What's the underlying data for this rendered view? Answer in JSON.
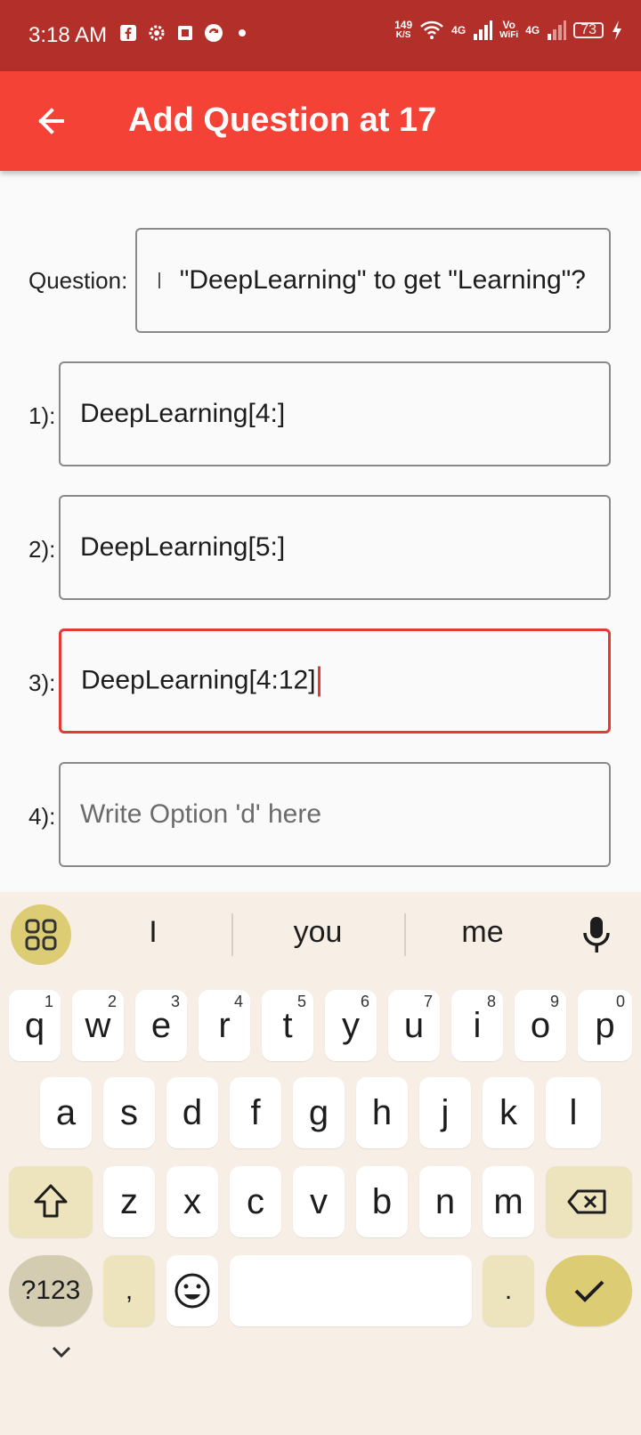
{
  "status_bar": {
    "time": "3:18 AM",
    "net_speed_value": "149",
    "net_speed_unit": "K/S",
    "network_label_1": "4G",
    "volte_label": "Vo",
    "volte_wifi_label": "WiFi",
    "network_label_2": "4G",
    "battery_level": "73",
    "icons": [
      "facebook-icon",
      "gear-icon",
      "notification-icon",
      "sync-icon",
      "dot-icon",
      "wifi-icon",
      "signal-icon",
      "charging-icon"
    ]
  },
  "app_bar": {
    "title": "Add Question at 17",
    "back_icon": "arrow-back-icon"
  },
  "form": {
    "question_label": "Question:",
    "question_value": "\"DeepLearning\" to get \"Learning\"?",
    "options": [
      {
        "label": "1):",
        "value": "DeepLearning[4:]",
        "placeholder": ""
      },
      {
        "label": "2):",
        "value": "DeepLearning[5:]",
        "placeholder": ""
      },
      {
        "label": "3):",
        "value": "DeepLearning[4:12]",
        "placeholder": ""
      },
      {
        "label": "4):",
        "value": "",
        "placeholder": "Write Option 'd' here"
      }
    ]
  },
  "keyboard": {
    "suggestions": [
      "I",
      "you",
      "me"
    ],
    "row1": [
      "q",
      "w",
      "e",
      "r",
      "t",
      "y",
      "u",
      "i",
      "o",
      "p"
    ],
    "row1_hints": [
      "1",
      "2",
      "3",
      "4",
      "5",
      "6",
      "7",
      "8",
      "9",
      "0"
    ],
    "row2": [
      "a",
      "s",
      "d",
      "f",
      "g",
      "h",
      "j",
      "k",
      "l"
    ],
    "row3": [
      "z",
      "x",
      "c",
      "v",
      "b",
      "n",
      "m"
    ],
    "symbols_label": "?123",
    "comma_label": ",",
    "period_label": ".",
    "colors": {
      "accent": "#f44336",
      "status": "#b3302a",
      "keyboard_bg": "#f7efe5",
      "enter": "#dccc74"
    }
  }
}
